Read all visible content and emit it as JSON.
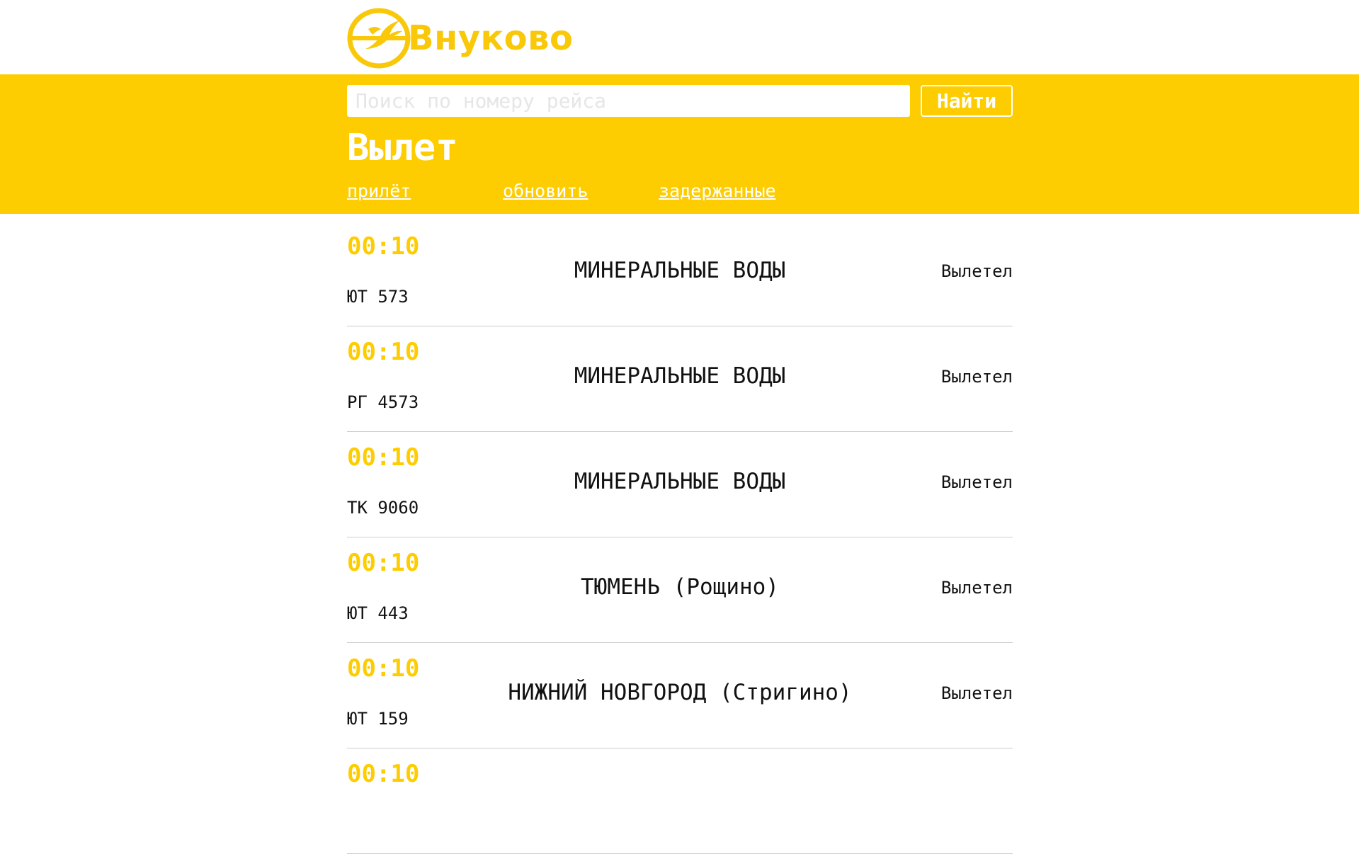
{
  "brand": {
    "name": "Внуково",
    "logo_icon": "vnukovo-pegasus-logo",
    "color": "#f9c809"
  },
  "colors": {
    "band": "#fdcd02",
    "time": "#fdcd02",
    "text": "#111111"
  },
  "search": {
    "placeholder": "Поиск по номеру рейса",
    "value": "",
    "button_label": "Найти"
  },
  "page": {
    "title": "Вылет"
  },
  "nav": {
    "items": [
      {
        "label": "прилёт"
      },
      {
        "label": "обновить"
      },
      {
        "label": "задержанные"
      }
    ]
  },
  "flights": [
    {
      "time": "00:10",
      "code": "ЮТ 573",
      "destination": "МИНЕРАЛЬНЫЕ ВОДЫ",
      "status": "Вылетел"
    },
    {
      "time": "00:10",
      "code": "РГ 4573",
      "destination": "МИНЕРАЛЬНЫЕ ВОДЫ",
      "status": "Вылетел"
    },
    {
      "time": "00:10",
      "code": "ТК 9060",
      "destination": "МИНЕРАЛЬНЫЕ ВОДЫ",
      "status": "Вылетел"
    },
    {
      "time": "00:10",
      "code": "ЮТ 443",
      "destination": "ТЮМЕНЬ (Рощино)",
      "status": "Вылетел"
    },
    {
      "time": "00:10",
      "code": "ЮТ 159",
      "destination": "НИЖНИЙ НОВГОРОД (Стригино)",
      "status": "Вылетел"
    },
    {
      "time": "00:10",
      "code": "",
      "destination": "",
      "status": ""
    }
  ]
}
